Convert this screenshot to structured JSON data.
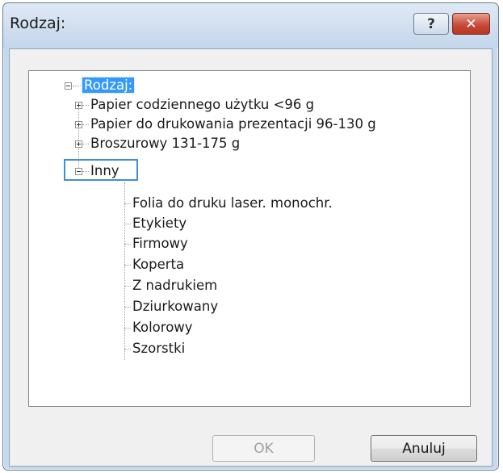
{
  "window": {
    "title": "Rodzaj:",
    "help_label": "?",
    "close_label": "✕"
  },
  "tree": {
    "root": "Rodzaj:",
    "categories": [
      {
        "label": "Papier codziennego użytku <96 g",
        "expanded": false
      },
      {
        "label": "Papier do drukowania prezentacji 96-130 g",
        "expanded": false
      },
      {
        "label": "Broszurowy 131-175 g",
        "expanded": false
      },
      {
        "label": "Inny",
        "expanded": true
      }
    ],
    "inny_children": [
      "Folia do druku laser. monochr.",
      "Etykiety",
      "Firmowy",
      "Koperta",
      "Z nadrukiem",
      "Dziurkowany",
      "Kolorowy",
      "Szorstki"
    ]
  },
  "buttons": {
    "ok_label": "OK",
    "cancel_label": "Anuluj"
  },
  "colors": {
    "selection": "#3399ff",
    "focus_border": "#3d8fd6",
    "close_button": "#c74c3a"
  }
}
